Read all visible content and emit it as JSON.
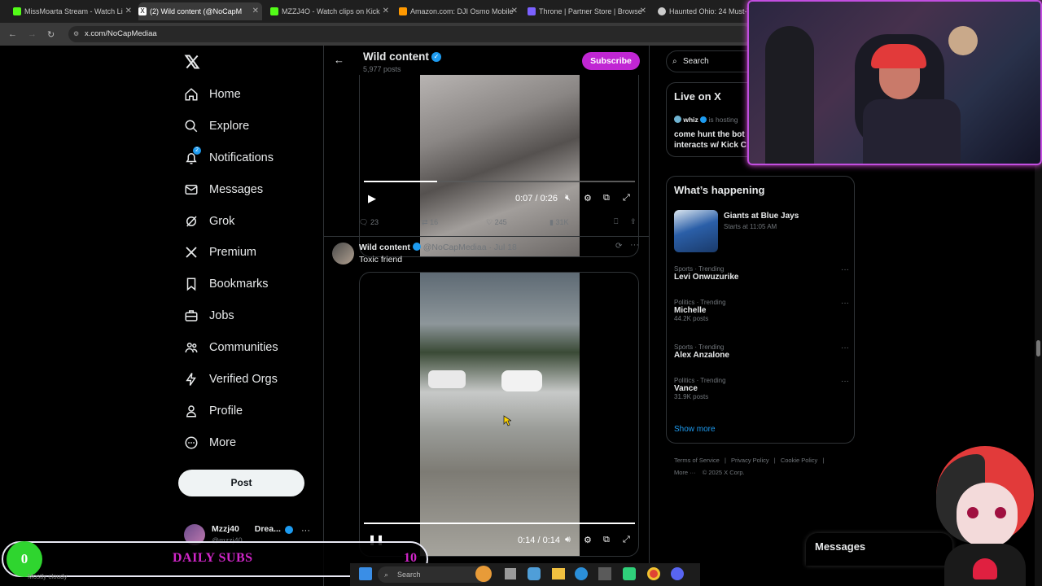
{
  "browser": {
    "tabs": [
      {
        "title": "MissMoarta Stream - Watch Li",
        "icon_color": "#53fc18"
      },
      {
        "title": "(2) Wild content (@NoCapM",
        "icon_color": "#ffffff"
      },
      {
        "title": "MZZJ4O - Watch clips on Kick",
        "icon_color": "#53fc18"
      },
      {
        "title": "Amazon.com: DJI Osmo Mobile",
        "icon_color": "#ff9900"
      },
      {
        "title": "Throne | Partner Store | Browse",
        "icon_color": "#7b61ff"
      },
      {
        "title": "Haunted Ohio: 24 Must-Vis",
        "icon_color": "#cccccc"
      }
    ],
    "url": "x.com/NoCapMediaa"
  },
  "sidebar": {
    "items": [
      {
        "label": "Home",
        "icon": "home-icon"
      },
      {
        "label": "Explore",
        "icon": "search-icon"
      },
      {
        "label": "Notifications",
        "icon": "bell-icon",
        "badge": "2"
      },
      {
        "label": "Messages",
        "icon": "mail-icon"
      },
      {
        "label": "Grok",
        "icon": "grok-icon"
      },
      {
        "label": "Premium",
        "icon": "x-logo-icon"
      },
      {
        "label": "Bookmarks",
        "icon": "bookmark-icon"
      },
      {
        "label": "Jobs",
        "icon": "briefcase-icon"
      },
      {
        "label": "Communities",
        "icon": "people-icon"
      },
      {
        "label": "Verified Orgs",
        "icon": "lightning-icon"
      },
      {
        "label": "Profile",
        "icon": "person-icon"
      },
      {
        "label": "More",
        "icon": "more-circle-icon"
      }
    ],
    "post_label": "Post",
    "account": {
      "name": "Mzzj40",
      "name_suffix": "Drea...",
      "handle": "@mzzj40"
    }
  },
  "profile_header": {
    "name": "Wild content",
    "posts": "5,977 posts",
    "subscribe_label": "Subscribe"
  },
  "post1": {
    "time": "0:07 / 0:26",
    "progress": 0.27,
    "replies": "23",
    "reposts": "16",
    "likes": "245",
    "views": "31K"
  },
  "post2": {
    "author": "Wild content",
    "handle": "@NoCapMediaa",
    "date": "· Jul 18",
    "text": "Toxic friend",
    "time": "0:14 / 0:14",
    "progress": 1.0
  },
  "right": {
    "search_placeholder": "Search",
    "live": {
      "title": "Live on X",
      "host": "whiz",
      "host_status": "is hosting",
      "line1": "come hunt the bot",
      "line2": "interacts w/ Kick C"
    },
    "happening": {
      "title": "What’s happening",
      "event_title": "Giants at Blue Jays",
      "event_time": "Starts at 11:05 AM",
      "trends": [
        {
          "category": "Sports · Trending",
          "name": "Levi Onwuzurike",
          "posts": ""
        },
        {
          "category": "Politics · Trending",
          "name": "Michelle",
          "posts": "44.2K posts"
        },
        {
          "category": "Sports · Trending",
          "name": "Alex Anzalone",
          "posts": ""
        },
        {
          "category": "Politics · Trending",
          "name": "Vance",
          "posts": "31.9K posts"
        }
      ],
      "show_more": "Show more"
    },
    "footer": {
      "links": [
        "Terms of Service",
        "Privacy Policy",
        "Cookie Policy"
      ],
      "more": "More ···",
      "copyright": "© 2025 X Corp."
    },
    "messages_label": "Messages"
  },
  "overlay": {
    "subs_count": "0",
    "subs_label": "DAILY SUBS",
    "subs_goal": "10",
    "taskbar_search": "Search",
    "status_text": "Mostly cloudy"
  },
  "colors": {
    "accent": "#1d9bf0",
    "subscribe": "#c026d3",
    "subs_green": "#2fd52f",
    "subs_text": "#d026c8"
  }
}
